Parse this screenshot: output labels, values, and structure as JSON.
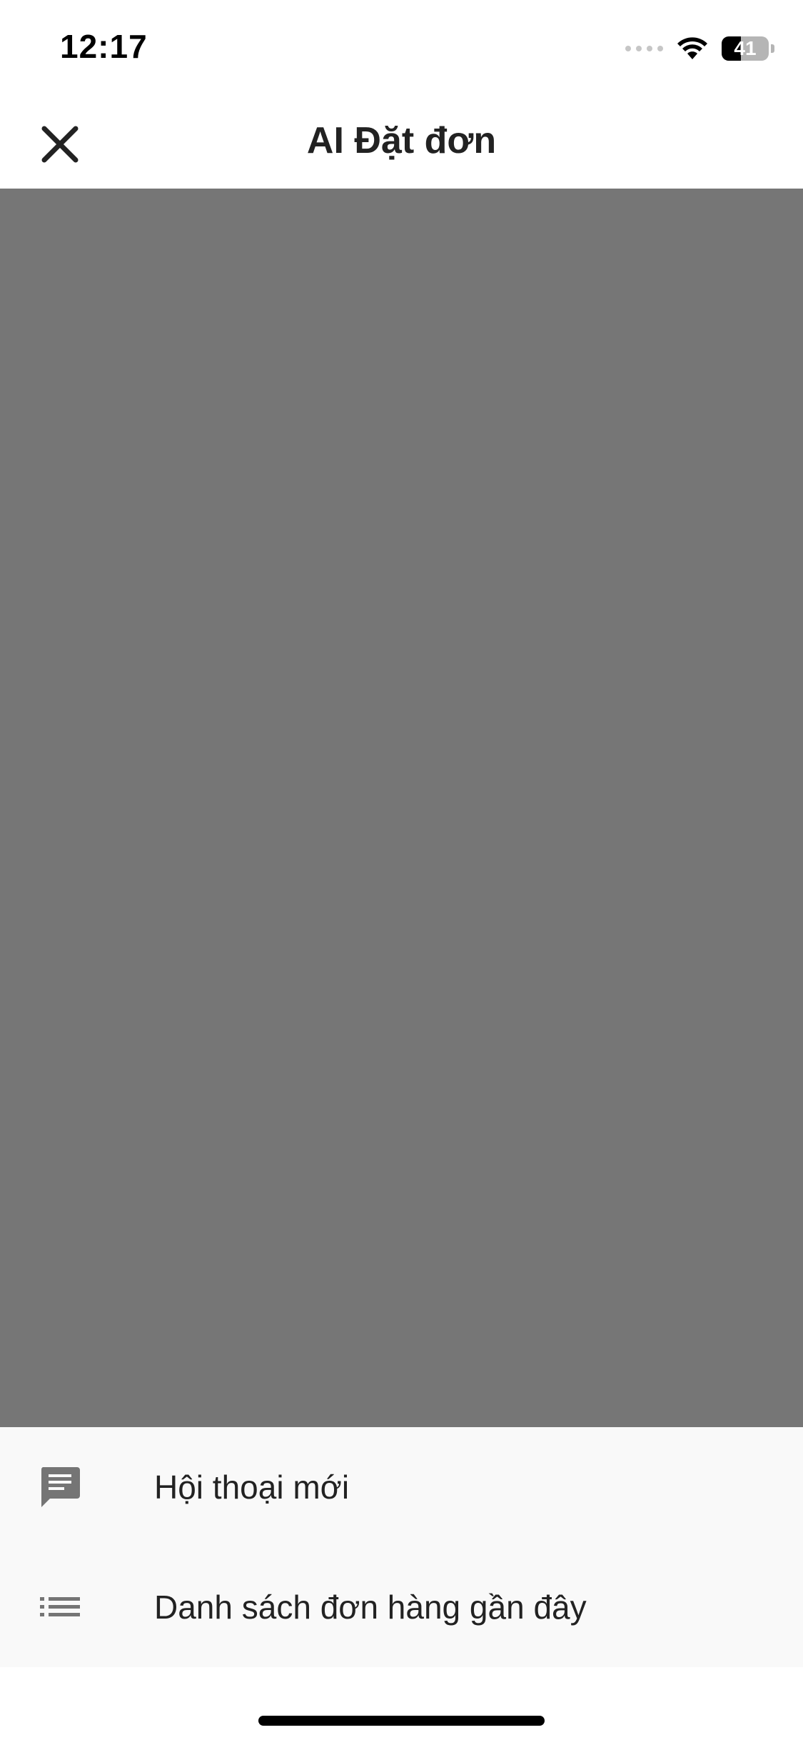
{
  "status_bar": {
    "time": "12:17",
    "battery_level": "41",
    "battery_percent": 41,
    "icons": [
      "signal-icon",
      "wifi-icon",
      "battery-icon"
    ]
  },
  "header": {
    "title": "AI Đặt đơn",
    "close_icon": "close-icon"
  },
  "sheet": {
    "items": [
      {
        "label": "Hội thoại mới",
        "icon": "chat-icon"
      },
      {
        "label": "Danh sách đơn hàng gần đây",
        "icon": "list-icon"
      }
    ]
  },
  "colors": {
    "overlay": "#767676",
    "sheet_background": "#f9f9f9",
    "icon_gray": "#757575",
    "text_dark": "#222222"
  }
}
